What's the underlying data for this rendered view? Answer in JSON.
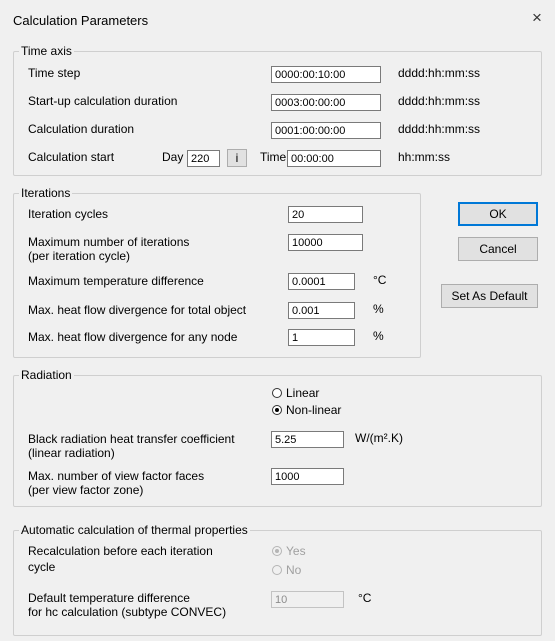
{
  "window": {
    "title": "Calculation Parameters",
    "close_glyph": "×"
  },
  "time_axis": {
    "legend": "Time axis",
    "time_step": {
      "label": "Time step",
      "value": "0000:00:10:00",
      "format": "dddd:hh:mm:ss"
    },
    "startup_duration": {
      "label": "Start-up calculation duration",
      "value": "0003:00:00:00",
      "format": "dddd:hh:mm:ss"
    },
    "calc_duration": {
      "label": "Calculation duration",
      "value": "0001:00:00:00",
      "format": "dddd:hh:mm:ss"
    },
    "calc_start": {
      "label": "Calculation start",
      "day_label": "Day",
      "day_value": "220",
      "info_label": "i",
      "time_label": "Time",
      "time_value": "00:00:00",
      "time_format": "hh:mm:ss"
    }
  },
  "iterations": {
    "legend": "Iterations",
    "cycles": {
      "label": "Iteration cycles",
      "value": "20"
    },
    "max_iterations": {
      "label1": "Maximum number of iterations",
      "label2": "(per iteration cycle)",
      "value": "10000"
    },
    "max_temp_diff": {
      "label": "Maximum temperature difference",
      "value": "0.0001",
      "unit": "°C"
    },
    "heat_total": {
      "label": "Max. heat flow divergence for total object",
      "value": "0.001",
      "unit": "%"
    },
    "heat_node": {
      "label": "Max. heat flow divergence for any node",
      "value": "1",
      "unit": "%"
    }
  },
  "radiation": {
    "legend": "Radiation",
    "linear": {
      "label": "Linear",
      "checked": false
    },
    "nonlinear": {
      "label": "Non-linear",
      "checked": true
    },
    "black_coeff": {
      "label1": "Black radiation heat transfer coefficient",
      "label2": "(linear radiation)",
      "value": "5.25",
      "unit": "W/(m².K)"
    },
    "view_factor": {
      "label1": "Max. number of view factor faces",
      "label2": "(per view factor zone)",
      "value": "1000"
    }
  },
  "thermal": {
    "legend": "Automatic calculation of thermal properties",
    "recalc": {
      "label1": "Recalculation before each iteration",
      "label2": "cycle",
      "yes": "Yes",
      "no": "No",
      "selected": "Yes"
    },
    "hc_diff": {
      "label1": "Default temperature difference",
      "label2": "for hc calculation (subtype CONVEC)",
      "value": "10",
      "unit": "°C"
    }
  },
  "buttons": {
    "ok": "OK",
    "cancel": "Cancel",
    "set_default": "Set As Default"
  }
}
